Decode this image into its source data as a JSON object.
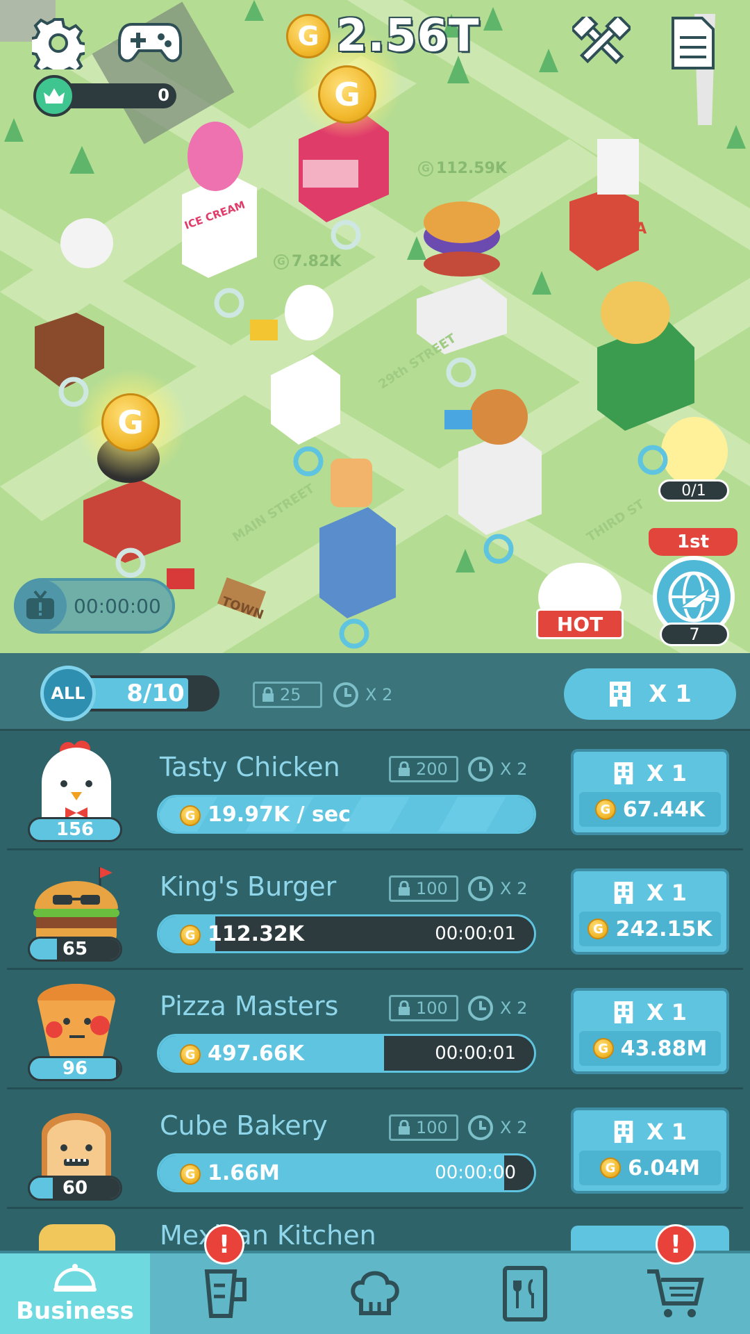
{
  "hud": {
    "gold_total": "2.56T",
    "coin_letter": "G",
    "crown_count": "0",
    "icons": [
      "gear-icon",
      "gamepad-icon",
      "tools-icon",
      "document-icon"
    ]
  },
  "map": {
    "floating_earnings": [
      "112.59K",
      "7.82K"
    ],
    "street_labels": [
      "MAIN STREET",
      "29th STREET",
      "THIRD ST",
      "TOWN"
    ],
    "ad_timer": "00:00:00",
    "egg_progress": "0/1",
    "rank_label": "1st",
    "globe_count": "7",
    "hot_label": "HOT",
    "building_signs": [
      "ICE CREAM",
      "PIZZA"
    ]
  },
  "panel": {
    "all_label": "ALL",
    "all_progress": "8/10",
    "all_progress_fraction": 0.8,
    "lock_value": "25",
    "time_multiplier": "X 2",
    "buy_multiplier": "X 1"
  },
  "businesses": [
    {
      "name": "Tasty Chicken",
      "level": "156",
      "level_fill": 1.0,
      "lock_value": "200",
      "time_multiplier": "X 2",
      "income": "19.97K / sec",
      "timer": "",
      "progress": 1.0,
      "buy_multiplier": "X 1",
      "cost": "67.44K"
    },
    {
      "name": "King's Burger",
      "level": "65",
      "level_fill": 0.3,
      "lock_value": "100",
      "time_multiplier": "X 2",
      "income": "112.32K",
      "timer": "00:00:01",
      "progress": 0.15,
      "buy_multiplier": "X 1",
      "cost": "242.15K"
    },
    {
      "name": "Pizza Masters",
      "level": "96",
      "level_fill": 0.95,
      "lock_value": "100",
      "time_multiplier": "X 2",
      "income": "497.66K",
      "timer": "00:00:01",
      "progress": 0.6,
      "buy_multiplier": "X 1",
      "cost": "43.88M"
    },
    {
      "name": "Cube Bakery",
      "level": "60",
      "level_fill": 0.25,
      "lock_value": "100",
      "time_multiplier": "X 2",
      "income": "1.66M",
      "timer": "00:00:00",
      "progress": 0.92,
      "buy_multiplier": "X 1",
      "cost": "6.04M"
    },
    {
      "name": "Mexican Kitchen"
    }
  ],
  "nav": {
    "items": [
      {
        "label": "Business",
        "icon": "cloche-icon",
        "active": true
      },
      {
        "label": "",
        "icon": "blender-icon",
        "alert": "!"
      },
      {
        "label": "",
        "icon": "chef-hat-icon"
      },
      {
        "label": "",
        "icon": "menu-book-icon"
      },
      {
        "label": "",
        "icon": "cart-icon",
        "alert": "!"
      }
    ]
  },
  "colors": {
    "accent": "#5ec4e0",
    "panel": "#2e6369",
    "alert": "#e8423a",
    "coin": "#f1b72a",
    "map": "#b5dc93"
  }
}
